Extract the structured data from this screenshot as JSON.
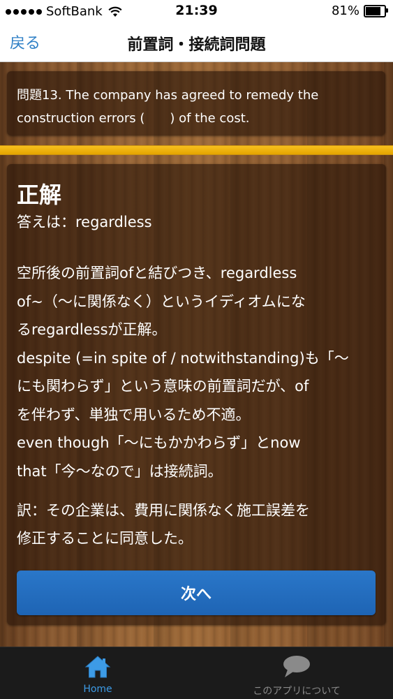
{
  "status_bar": {
    "carrier": "SoftBank",
    "time": "21:39",
    "battery_percent": "81%",
    "battery_level": 0.81
  },
  "nav": {
    "back_label": "戻る",
    "title": "前置詞・接続詞問題"
  },
  "question": {
    "line1": "問題13. The company has agreed to remedy the",
    "line2": "construction errors (　　) of the cost."
  },
  "progress": {
    "fraction": 1.0
  },
  "answer": {
    "heading": "正解",
    "answer_line": "答えは：regardless",
    "explanation_lines": [
      "空所後の前置詞ofと結びつき、regardless",
      "of~（～に関係なく）というイディオムにな",
      "るregardlessが正解。",
      "despite (=in spite of / notwithstanding)も「～",
      "にも関わらず」という意味の前置詞だが、of",
      "を伴わず、単独で用いるため不適。",
      "even though「～にもかかわらず」とnow",
      "that「今～なので」は接続詞。"
    ],
    "translation_lines": [
      "訳：その企業は、費用に関係なく施工誤差を",
      "修正することに同意した。"
    ],
    "next_label": "次へ"
  },
  "tab_bar": {
    "home_label": "Home",
    "about_label": "このアプリについて",
    "active_color": "#3d9be6",
    "inactive_color": "#8a8a8a"
  },
  "icons": {
    "home": "house-icon",
    "about": "speech-bubble-icon"
  }
}
